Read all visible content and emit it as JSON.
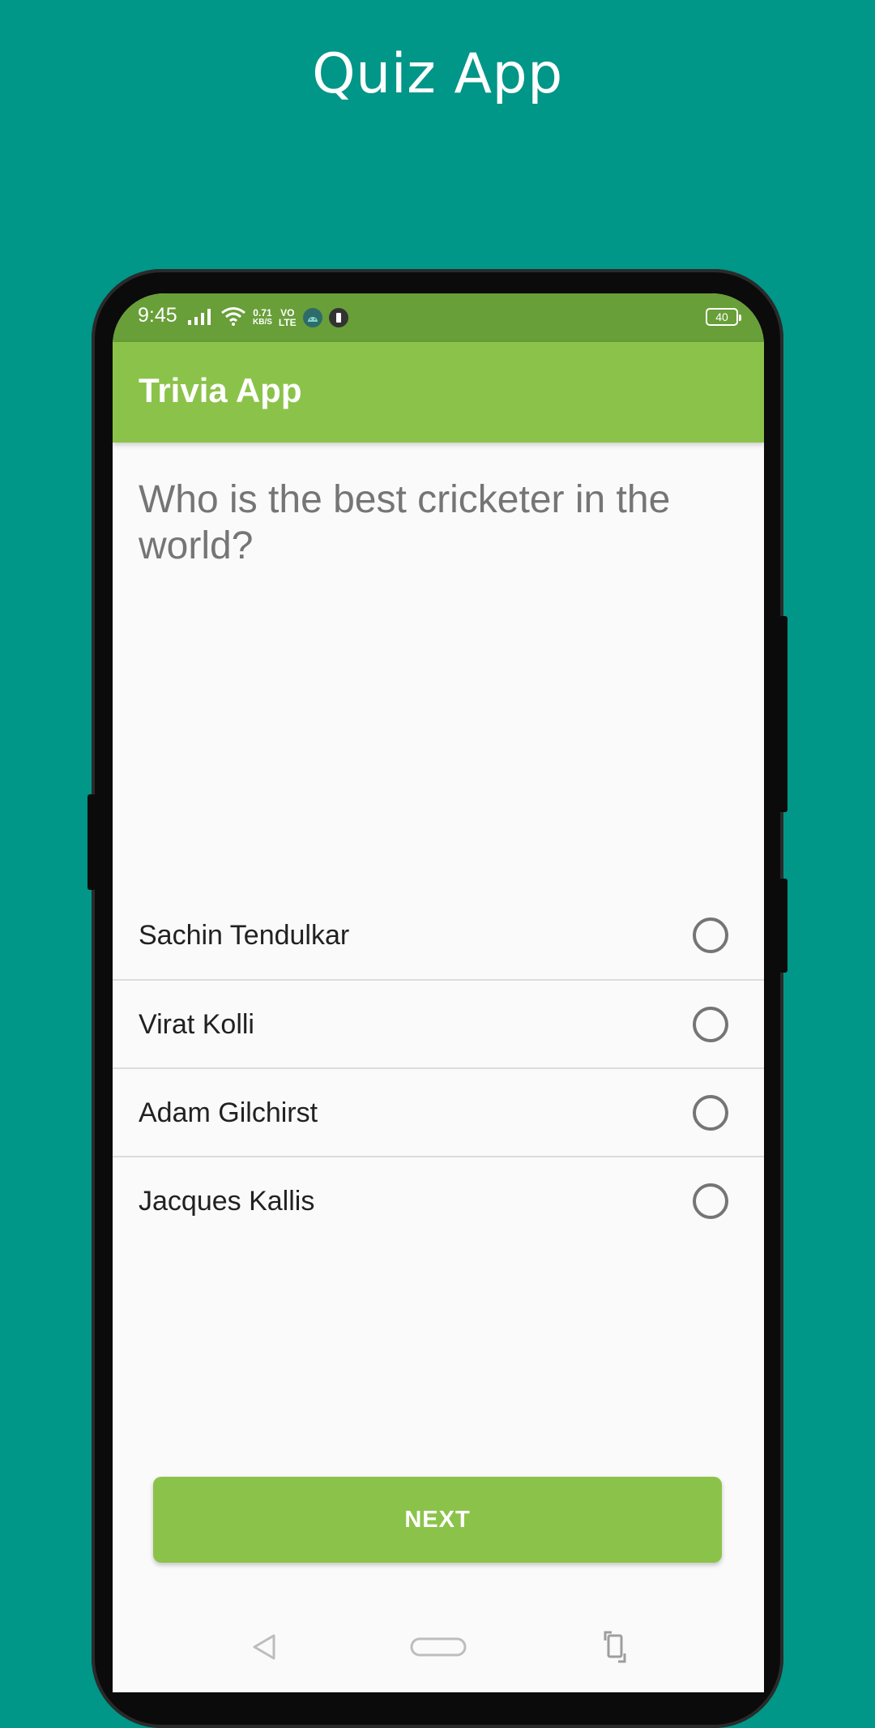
{
  "promo": {
    "title": "Quiz App"
  },
  "status_bar": {
    "time": "9:45",
    "net_speed_value": "0.71",
    "net_speed_unit": "KB/S",
    "network_top": "VO",
    "network_bottom": "LTE",
    "battery": "40"
  },
  "app_bar": {
    "title": "Trivia App"
  },
  "quiz": {
    "question": "Who is the best cricketer in the world?",
    "options": [
      {
        "label": "Sachin Tendulkar",
        "selected": false
      },
      {
        "label": "Virat Kolli",
        "selected": false
      },
      {
        "label": "Adam Gilchirst",
        "selected": false
      },
      {
        "label": "Jacques Kallis",
        "selected": false
      }
    ],
    "next_label": "NEXT"
  },
  "colors": {
    "background": "#009688",
    "status_bar": "#689f38",
    "app_bar": "#8bc34a",
    "button": "#8bc34a"
  },
  "icons": [
    "signal-icon",
    "wifi-icon",
    "android-icon",
    "notification-icon",
    "battery-icon",
    "back-icon",
    "home-icon",
    "rotate-icon"
  ]
}
